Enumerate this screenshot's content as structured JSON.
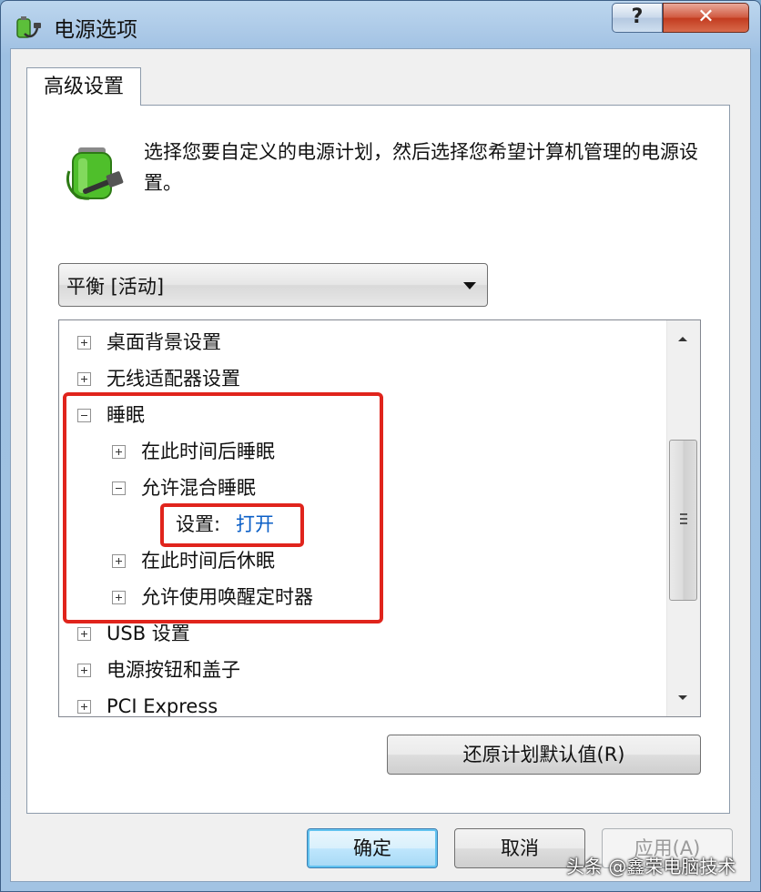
{
  "window": {
    "title": "电源选项",
    "help_label": "?",
    "close_label": "✕"
  },
  "tab": {
    "label": "高级设置"
  },
  "description": "选择您要自定义的电源计划，然后选择您希望计算机管理的电源设置。",
  "plan_select": {
    "value": "平衡 [活动]"
  },
  "tree": {
    "items": [
      {
        "label": "桌面背景设置",
        "expander": "+"
      },
      {
        "label": "无线适配器设置",
        "expander": "+"
      },
      {
        "label": "睡眠",
        "expander": "−"
      },
      {
        "label": "在此时间后睡眠",
        "expander": "+"
      },
      {
        "label": "允许混合睡眠",
        "expander": "−"
      },
      {
        "label": "设置:",
        "value": "打开"
      },
      {
        "label": "在此时间后休眠",
        "expander": "+"
      },
      {
        "label": "允许使用唤醒定时器",
        "expander": "+"
      },
      {
        "label": "USB 设置",
        "expander": "+"
      },
      {
        "label": "电源按钮和盖子",
        "expander": "+"
      },
      {
        "label": "PCI Express",
        "expander": "+"
      }
    ]
  },
  "buttons": {
    "restore_defaults": "还原计划默认值(R)",
    "ok": "确定",
    "cancel": "取消",
    "apply": "应用(A)"
  },
  "highlight_color": "#e0241c",
  "link_color": "#0b5fc7",
  "watermark": "头条 @鑫荣电脑技术"
}
